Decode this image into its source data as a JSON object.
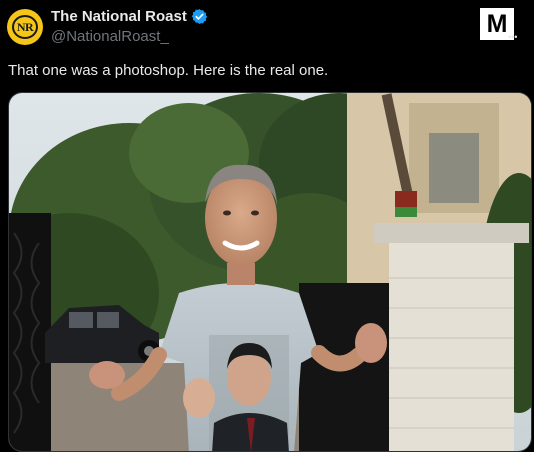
{
  "account": {
    "display_name": "The National Roast",
    "handle": "@NationalRoast_",
    "avatar_text": "NR",
    "verified": true
  },
  "brand_logo_text": "M",
  "tweet": {
    "text": "That one was a photoshop. Here is the real one."
  },
  "media": {
    "icon": "photo-icon"
  },
  "colors": {
    "background": "#000000",
    "text": "#e7e9ea",
    "muted": "#71767b",
    "verified_blue": "#1d9bf0",
    "avatar_yellow": "#f5c518"
  }
}
